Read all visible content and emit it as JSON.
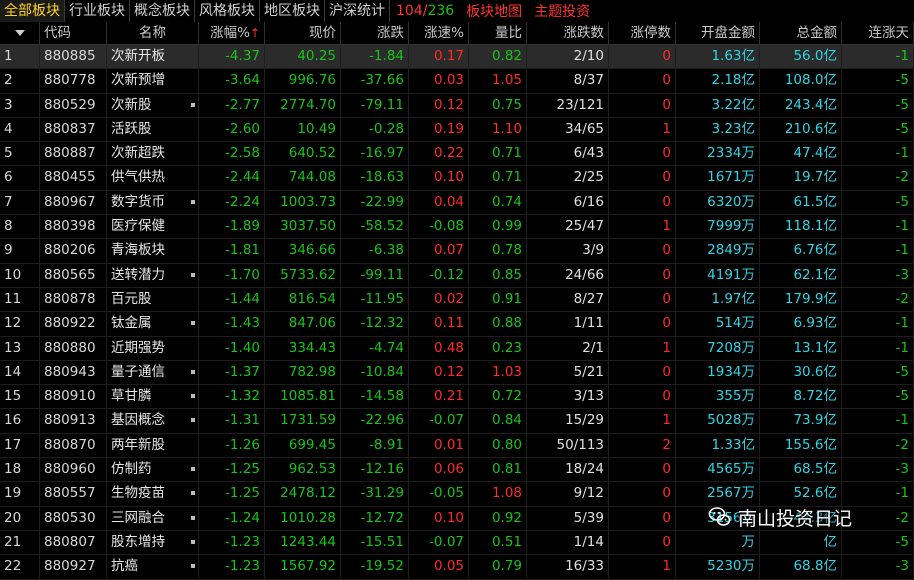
{
  "tabs": [
    {
      "label": "全部板块",
      "active": true
    },
    {
      "label": "行业板块",
      "active": false
    },
    {
      "label": "概念板块",
      "active": false
    },
    {
      "label": "风格板块",
      "active": false
    },
    {
      "label": "地区板块",
      "active": false
    },
    {
      "label": "沪深统计",
      "active": false
    }
  ],
  "count": {
    "current": "104",
    "total": "236"
  },
  "links": [
    "板块地图",
    "主题投资"
  ],
  "headers": [
    "代码",
    "名称",
    "涨幅%",
    "现价",
    "涨跌",
    "涨速%",
    "量比",
    "涨跌数",
    "涨停数",
    "开盘金额",
    "总金额",
    "连涨天"
  ],
  "sort_indicator": "↑",
  "rows": [
    {
      "idx": "1",
      "code": "880885",
      "name": "次新开板",
      "dot": false,
      "pct": "-4.37",
      "price": "40.25",
      "chg": "-1.84",
      "speed": "0.17",
      "vr": "0.82",
      "updown": "2/10",
      "limit": "0",
      "open": "1.63亿",
      "total": "56.0亿",
      "streak": "-1"
    },
    {
      "idx": "2",
      "code": "880778",
      "name": "次新预增",
      "dot": false,
      "pct": "-3.64",
      "price": "996.76",
      "chg": "-37.66",
      "speed": "0.03",
      "vr": "1.05",
      "updown": "8/37",
      "limit": "0",
      "open": "2.18亿",
      "total": "108.0亿",
      "streak": "-5"
    },
    {
      "idx": "3",
      "code": "880529",
      "name": "次新股",
      "dot": true,
      "pct": "-2.77",
      "price": "2774.70",
      "chg": "-79.11",
      "speed": "0.12",
      "vr": "0.75",
      "updown": "23/121",
      "limit": "0",
      "open": "3.22亿",
      "total": "243.4亿",
      "streak": "-5"
    },
    {
      "idx": "4",
      "code": "880837",
      "name": "活跃股",
      "dot": false,
      "pct": "-2.60",
      "price": "10.49",
      "chg": "-0.28",
      "speed": "0.19",
      "vr": "1.10",
      "updown": "34/65",
      "limit": "1",
      "open": "3.23亿",
      "total": "210.6亿",
      "streak": "-5"
    },
    {
      "idx": "5",
      "code": "880887",
      "name": "次新超跌",
      "dot": false,
      "pct": "-2.58",
      "price": "640.52",
      "chg": "-16.97",
      "speed": "0.22",
      "vr": "0.71",
      "updown": "6/43",
      "limit": "0",
      "open": "2334万",
      "total": "47.4亿",
      "streak": "-1"
    },
    {
      "idx": "6",
      "code": "880455",
      "name": "供气供热",
      "dot": false,
      "pct": "-2.44",
      "price": "744.08",
      "chg": "-18.63",
      "speed": "0.10",
      "vr": "0.71",
      "updown": "2/25",
      "limit": "0",
      "open": "1671万",
      "total": "19.7亿",
      "streak": "-2"
    },
    {
      "idx": "7",
      "code": "880967",
      "name": "数字货币",
      "dot": true,
      "pct": "-2.24",
      "price": "1003.73",
      "chg": "-22.99",
      "speed": "0.04",
      "vr": "0.74",
      "updown": "6/16",
      "limit": "0",
      "open": "6320万",
      "total": "61.5亿",
      "streak": "-5"
    },
    {
      "idx": "8",
      "code": "880398",
      "name": "医疗保健",
      "dot": false,
      "pct": "-1.89",
      "price": "3037.50",
      "chg": "-58.52",
      "speed": "-0.08",
      "vr": "0.99",
      "updown": "25/47",
      "limit": "1",
      "open": "7999万",
      "total": "118.1亿",
      "streak": "-1"
    },
    {
      "idx": "9",
      "code": "880206",
      "name": "青海板块",
      "dot": false,
      "pct": "-1.81",
      "price": "346.66",
      "chg": "-6.38",
      "speed": "0.07",
      "vr": "0.78",
      "updown": "3/9",
      "limit": "0",
      "open": "2849万",
      "total": "6.76亿",
      "streak": "-1"
    },
    {
      "idx": "10",
      "code": "880565",
      "name": "送转潜力",
      "dot": true,
      "pct": "-1.70",
      "price": "5733.62",
      "chg": "-99.11",
      "speed": "-0.12",
      "vr": "0.85",
      "updown": "24/66",
      "limit": "0",
      "open": "4191万",
      "total": "62.1亿",
      "streak": "-3"
    },
    {
      "idx": "11",
      "code": "880878",
      "name": "百元股",
      "dot": false,
      "pct": "-1.44",
      "price": "816.54",
      "chg": "-11.95",
      "speed": "0.02",
      "vr": "0.91",
      "updown": "8/27",
      "limit": "0",
      "open": "1.97亿",
      "total": "179.9亿",
      "streak": "-2"
    },
    {
      "idx": "12",
      "code": "880922",
      "name": "钛金属",
      "dot": true,
      "pct": "-1.43",
      "price": "847.06",
      "chg": "-12.32",
      "speed": "0.11",
      "vr": "0.88",
      "updown": "1/11",
      "limit": "0",
      "open": "514万",
      "total": "6.93亿",
      "streak": "-1"
    },
    {
      "idx": "13",
      "code": "880880",
      "name": "近期强势",
      "dot": false,
      "pct": "-1.40",
      "price": "334.43",
      "chg": "-4.74",
      "speed": "0.48",
      "vr": "0.23",
      "updown": "2/1",
      "limit": "1",
      "open": "7208万",
      "total": "13.1亿",
      "streak": "-1"
    },
    {
      "idx": "14",
      "code": "880943",
      "name": "量子通信",
      "dot": true,
      "pct": "-1.37",
      "price": "782.98",
      "chg": "-10.84",
      "speed": "0.12",
      "vr": "1.03",
      "updown": "5/21",
      "limit": "0",
      "open": "1934万",
      "total": "30.6亿",
      "streak": "-5"
    },
    {
      "idx": "15",
      "code": "880910",
      "name": "草甘膦",
      "dot": true,
      "pct": "-1.32",
      "price": "1085.81",
      "chg": "-14.58",
      "speed": "0.21",
      "vr": "0.72",
      "updown": "3/13",
      "limit": "0",
      "open": "355万",
      "total": "8.72亿",
      "streak": "-5"
    },
    {
      "idx": "16",
      "code": "880913",
      "name": "基因概念",
      "dot": true,
      "pct": "-1.31",
      "price": "1731.59",
      "chg": "-22.96",
      "speed": "-0.07",
      "vr": "0.84",
      "updown": "15/29",
      "limit": "1",
      "open": "5028万",
      "total": "73.9亿",
      "streak": "-1"
    },
    {
      "idx": "17",
      "code": "880870",
      "name": "两年新股",
      "dot": false,
      "pct": "-1.26",
      "price": "699.45",
      "chg": "-8.91",
      "speed": "0.01",
      "vr": "0.80",
      "updown": "50/113",
      "limit": "2",
      "open": "1.33亿",
      "total": "155.6亿",
      "streak": "-2"
    },
    {
      "idx": "18",
      "code": "880960",
      "name": "仿制药",
      "dot": true,
      "pct": "-1.25",
      "price": "962.53",
      "chg": "-12.16",
      "speed": "0.06",
      "vr": "0.81",
      "updown": "18/24",
      "limit": "0",
      "open": "4565万",
      "total": "68.5亿",
      "streak": "-3"
    },
    {
      "idx": "19",
      "code": "880557",
      "name": "生物疫苗",
      "dot": true,
      "pct": "-1.25",
      "price": "2478.12",
      "chg": "-31.29",
      "speed": "-0.05",
      "vr": "1.08",
      "updown": "9/12",
      "limit": "0",
      "open": "2567万",
      "total": "52.6亿",
      "streak": "-1"
    },
    {
      "idx": "20",
      "code": "880530",
      "name": "三网融合",
      "dot": true,
      "pct": "-1.24",
      "price": "1010.28",
      "chg": "-12.72",
      "speed": "0.10",
      "vr": "0.92",
      "updown": "5/39",
      "limit": "0",
      "open": "3156万",
      "total": "47.3亿",
      "streak": "-2"
    },
    {
      "idx": "21",
      "code": "880807",
      "name": "股东增持",
      "dot": true,
      "pct": "-1.23",
      "price": "1243.44",
      "chg": "-15.51",
      "speed": "-0.07",
      "vr": "0.51",
      "updown": "1/14",
      "limit": "0",
      "open": "万",
      "total": "亿",
      "streak": "-5"
    },
    {
      "idx": "22",
      "code": "880927",
      "name": "抗癌",
      "dot": true,
      "pct": "-1.23",
      "price": "1567.92",
      "chg": "-19.52",
      "speed": "0.05",
      "vr": "0.79",
      "updown": "16/33",
      "limit": "1",
      "open": "5230万",
      "total": "68.8亿",
      "streak": "-3"
    }
  ],
  "watermark": "南山投资日记",
  "colors": {
    "down": "#18c418",
    "up": "#ff2a2a",
    "amount": "#2fd5e5",
    "active_tab": "#ffd21a"
  }
}
